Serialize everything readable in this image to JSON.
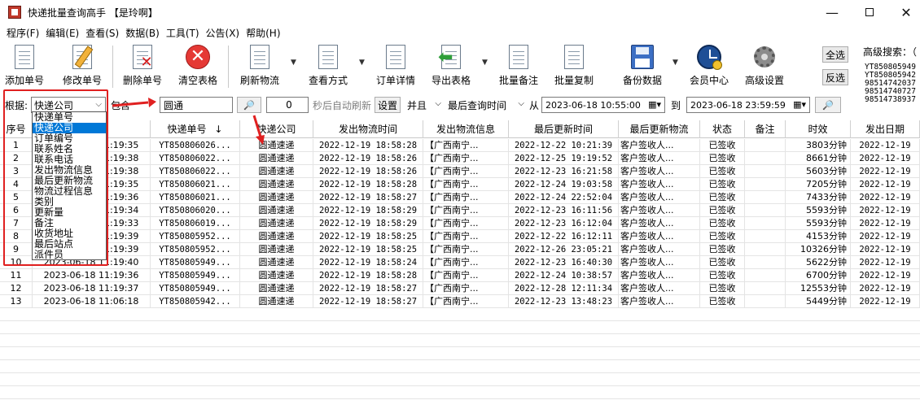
{
  "window": {
    "title": "快递批量查询高手 【是玲啊】",
    "min_glyph": "—",
    "close_glyph": "✕"
  },
  "menu": [
    "程序(F)",
    "编辑(E)",
    "查看(S)",
    "数据(B)",
    "工具(T)",
    "公告(X)",
    "帮助(H)"
  ],
  "toolbar": {
    "add": "添加单号",
    "edit": "修改单号",
    "delete": "删除单号",
    "clear": "清空表格",
    "refresh": "刷新物流",
    "view_mode": "查看方式",
    "order_detail": "订单详情",
    "export": "导出表格",
    "batch_note": "批量备注",
    "batch_copy": "批量复制",
    "backup": "备份数据",
    "member": "会员中心",
    "settings": "高级设置",
    "select_all": "全选",
    "invert": "反选",
    "advanced_search": "高级搜索：（",
    "advanced_list": [
      "YT850805949",
      "YT850805942",
      "98514742037",
      "98514740727",
      "98514738937"
    ]
  },
  "filter": {
    "by_label": "根据:",
    "field_selected": "快递公司",
    "match_mode": "包含",
    "keyword": "圆通",
    "search_glyph": "🔎",
    "interval": "0",
    "auto_refresh_label": "秒后自动刷新",
    "settings_button": "设置",
    "logic": "并且",
    "time_field": "最后查询时间",
    "from_label": "从",
    "from_value": "2023-06-18 10:55:00",
    "to_label": "到",
    "to_value": "2023-06-18 23:59:59"
  },
  "dropdown_options": [
    "快递单号",
    "快递公司",
    "订单编号",
    "联系姓名",
    "联系电话",
    "发出物流信息",
    "最后更新物流",
    "物流过程信息",
    "类别",
    "更新量",
    "备注",
    "收货地址",
    "最后站点",
    "派件员"
  ],
  "dropdown_selected_index": 1,
  "table": {
    "columns": [
      "序号",
      "间",
      "快递单号",
      "快递公司",
      "发出物流时间",
      "发出物流信息",
      "最后更新时间",
      "最后更新物流",
      "状态",
      "备注",
      "时效",
      "发出日期"
    ],
    "sort_glyph": "↓",
    "rows": [
      [
        "1",
        "2023-06-18 11:19:35",
        "YT850806026...",
        "圆通速递",
        "2022-12-19 18:58:28",
        "【广西南宁...",
        "2022-12-22 10:21:39",
        "客户签收人...",
        "已签收",
        "",
        "3803分钟",
        "2022-12-19"
      ],
      [
        "2",
        "2023-06-18 11:19:38",
        "YT850806022...",
        "圆通速递",
        "2022-12-19 18:58:26",
        "【广西南宁...",
        "2022-12-25 19:19:52",
        "客户签收人...",
        "已签收",
        "",
        "8661分钟",
        "2022-12-19"
      ],
      [
        "3",
        "2023-06-18 11:19:38",
        "YT850806022...",
        "圆通速递",
        "2022-12-19 18:58:26",
        "【广西南宁...",
        "2022-12-23 16:21:58",
        "客户签收人...",
        "已签收",
        "",
        "5603分钟",
        "2022-12-19"
      ],
      [
        "4",
        "2023-06-18 11:19:35",
        "YT850806021...",
        "圆通速递",
        "2022-12-19 18:58:28",
        "【广西南宁...",
        "2022-12-24 19:03:58",
        "客户签收人...",
        "已签收",
        "",
        "7205分钟",
        "2022-12-19"
      ],
      [
        "5",
        "2023-06-18 11:19:36",
        "YT850806021...",
        "圆通速递",
        "2022-12-19 18:58:27",
        "【广西南宁...",
        "2022-12-24 22:52:04",
        "客户签收人...",
        "已签收",
        "",
        "7433分钟",
        "2022-12-19"
      ],
      [
        "6",
        "2023-06-18 11:19:34",
        "YT850806020...",
        "圆通速递",
        "2022-12-19 18:58:29",
        "【广西南宁...",
        "2022-12-23 16:11:56",
        "客户签收人...",
        "已签收",
        "",
        "5593分钟",
        "2022-12-19"
      ],
      [
        "7",
        "2023-06-18 11:19:33",
        "YT850806019...",
        "圆通速递",
        "2022-12-19 18:58:29",
        "【广西南宁...",
        "2022-12-23 16:12:04",
        "客户签收人...",
        "已签收",
        "",
        "5593分钟",
        "2022-12-19"
      ],
      [
        "8",
        "2023-06-18 11:19:39",
        "YT850805952...",
        "圆通速递",
        "2022-12-19 18:58:25",
        "【广西南宁...",
        "2022-12-22 16:12:11",
        "客户签收人...",
        "已签收",
        "",
        "4153分钟",
        "2022-12-19"
      ],
      [
        "9",
        "2023-06-18 11:19:39",
        "YT850805952...",
        "圆通速递",
        "2022-12-19 18:58:25",
        "【广西南宁...",
        "2022-12-26 23:05:21",
        "客户签收人...",
        "已签收",
        "",
        "10326分钟",
        "2022-12-19"
      ],
      [
        "10",
        "2023-06-18 11:19:40",
        "YT850805949...",
        "圆通速递",
        "2022-12-19 18:58:24",
        "【广西南宁...",
        "2022-12-23 16:40:30",
        "客户签收人...",
        "已签收",
        "",
        "5622分钟",
        "2022-12-19"
      ],
      [
        "11",
        "2023-06-18 11:19:36",
        "YT850805949...",
        "圆通速递",
        "2022-12-19 18:58:28",
        "【广西南宁...",
        "2022-12-24 10:38:57",
        "客户签收人...",
        "已签收",
        "",
        "6700分钟",
        "2022-12-19"
      ],
      [
        "12",
        "2023-06-18 11:19:37",
        "YT850805949...",
        "圆通速递",
        "2022-12-19 18:58:27",
        "【广西南宁...",
        "2022-12-28 12:11:34",
        "客户签收人...",
        "已签收",
        "",
        "12553分钟",
        "2022-12-19"
      ],
      [
        "13",
        "2023-06-18 11:06:18",
        "YT850805942...",
        "圆通速递",
        "2022-12-19 18:58:27",
        "【广西南宁...",
        "2022-12-23 13:48:23",
        "客户签收人...",
        "已签收",
        "",
        "5449分钟",
        "2022-12-19"
      ]
    ]
  },
  "colors": {
    "selection": "#0078d7",
    "annotation_red": "#e02020"
  }
}
